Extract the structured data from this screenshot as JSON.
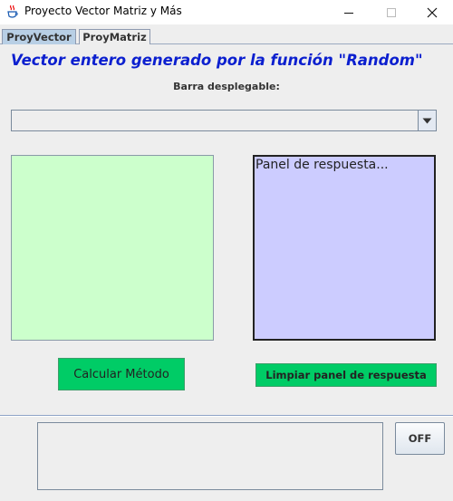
{
  "window": {
    "title": "Proyecto Vector Matriz y Más",
    "icon": "java-cup-icon",
    "controls": [
      "minimize-icon",
      "maximize-icon",
      "close-icon"
    ]
  },
  "tabs": [
    {
      "label": "ProyVector",
      "selected": true
    },
    {
      "label": "ProyMatriz",
      "selected": false
    }
  ],
  "main": {
    "heading": "Vector entero generado por la función \"Random\"",
    "dropdown_label": "Barra desplegable:",
    "dropdown_value": "",
    "response_panel_text": "Panel de respuesta...",
    "calc_button": "Calcular Método",
    "clear_button": "Limpiar panel de respuesta"
  },
  "bottom": {
    "off_button": "OFF"
  },
  "colors": {
    "heading": "#0b1fcf",
    "green_panel": "#ccffcc",
    "blue_panel": "#ccccff",
    "button_green": "#00cc66",
    "selected_tab": "#b8cfe5"
  }
}
